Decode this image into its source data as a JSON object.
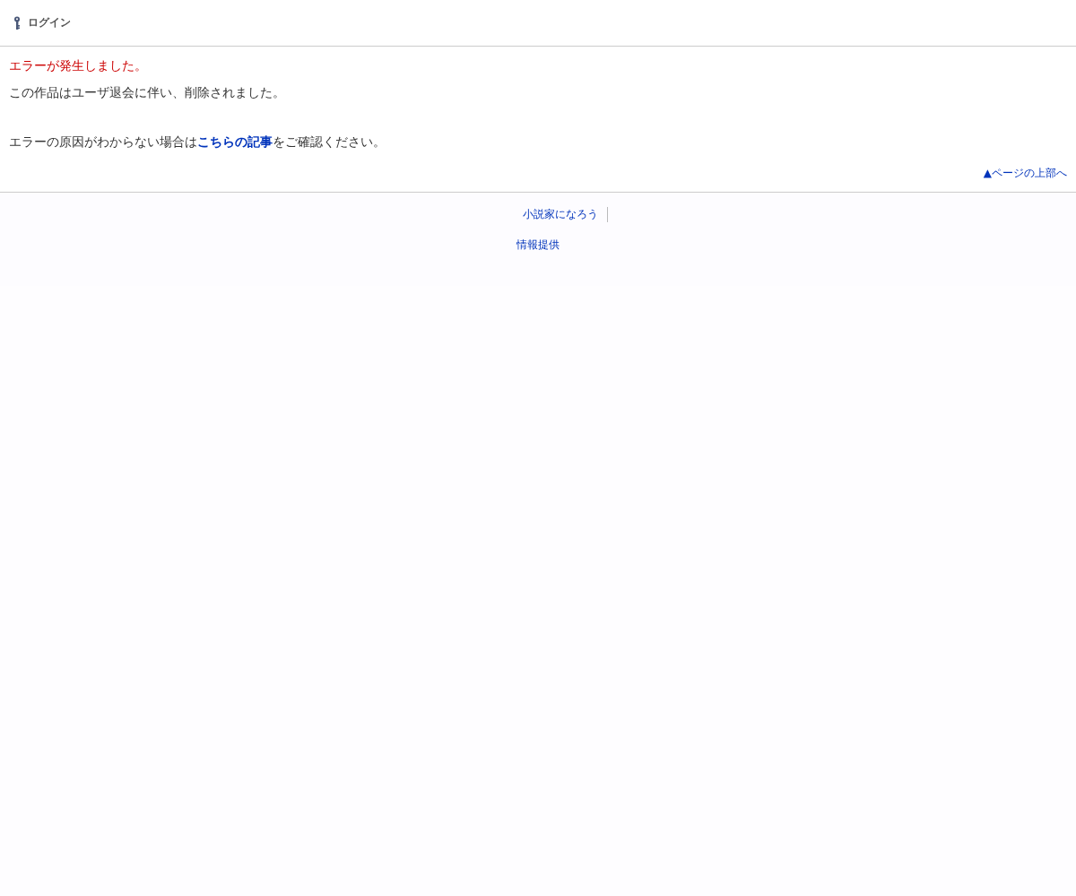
{
  "header": {
    "login_link": "ログイン"
  },
  "error": {
    "title": "エラーが発生しました。",
    "message": "この作品はユーザ退会に伴い、削除されました。",
    "help_before": "エラーの原因がわからない場合は",
    "help_link": "こちらの記事",
    "help_after": "をご確認ください。"
  },
  "page_top_link": "▲ページの上部へ",
  "footer": {
    "links": [
      "小説家になろう"
    ],
    "info_link": "情報提供"
  }
}
